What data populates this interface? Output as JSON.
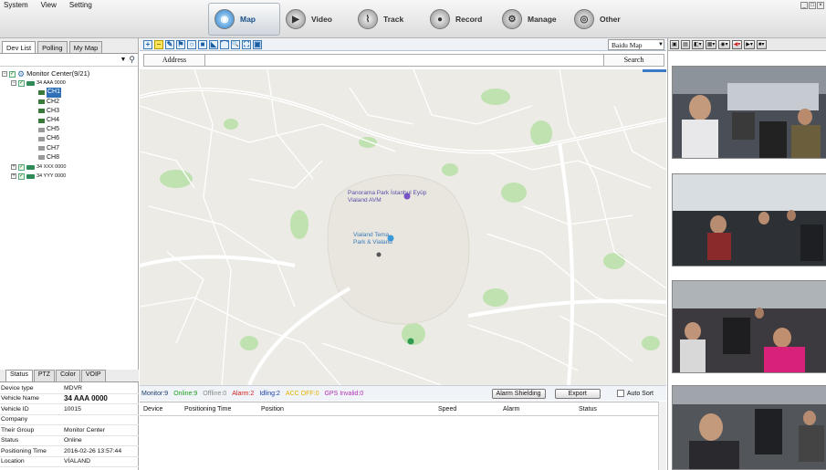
{
  "menu": [
    "System",
    "View",
    "Setting"
  ],
  "nav": [
    {
      "label": "Map",
      "icon": "globe-icon",
      "active": true
    },
    {
      "label": "Video",
      "icon": "video-icon",
      "active": false
    },
    {
      "label": "Track",
      "icon": "track-icon",
      "active": false
    },
    {
      "label": "Record",
      "icon": "record-icon",
      "active": false
    },
    {
      "label": "Manage",
      "icon": "manage-icon",
      "active": false
    },
    {
      "label": "Other",
      "icon": "other-icon",
      "active": false
    }
  ],
  "left_tabs": [
    "Dev List",
    "Polling",
    "My Map"
  ],
  "tree": {
    "root": "Monitor Center(9/21)",
    "vehicle1": "34 AAA 0000",
    "channels": [
      "CH1",
      "CH2",
      "CH3",
      "CH4",
      "CH5",
      "CH6",
      "CH7",
      "CH8"
    ],
    "vehicle2": "34 XXX 0000",
    "vehicle3": "34 YYY 0000"
  },
  "status_tabs": [
    "Status",
    "PTZ",
    "Color",
    "VOIP"
  ],
  "info": [
    {
      "k": "Device type",
      "v": "MDVR"
    },
    {
      "k": "Vehicle Name",
      "v": "34 AAA 0000"
    },
    {
      "k": "Vehicle ID",
      "v": "10015"
    },
    {
      "k": "Company",
      "v": ""
    },
    {
      "k": "Their Group",
      "v": "Monitor Center"
    },
    {
      "k": "Status",
      "v": "Online"
    },
    {
      "k": "Positioning Time",
      "v": "2016-02-26 13:57:44"
    },
    {
      "k": "Location",
      "v": "VİALAND"
    }
  ],
  "map_toolbar": [
    "+",
    "−",
    "✎",
    "⚑",
    "○",
    "■",
    "◣",
    "⌒",
    "🔍",
    "⛶",
    "▣"
  ],
  "map_select": "Baidu Map",
  "address_label": "Address",
  "search_label": "Search",
  "map_labels": {
    "park1": "Panorama Park İstanbul Eyüp Vialand AVM",
    "park2": "Vialand Tema Park & Vialand"
  },
  "counts": {
    "monitor": "Monitor:9",
    "online": "Online:9",
    "offline": "Offline:0",
    "alarm": "Alarm:2",
    "idling": "Idling:2",
    "acc_off": "ACC OFF:0",
    "gps_invalid": "GPS Invalid:0"
  },
  "buttons": {
    "alarm_shielding": "Alarm Shielding",
    "export": "Export",
    "auto_sort": "Auto Sort"
  },
  "grid_columns": [
    "Device",
    "Positioning Time",
    "Position",
    "Speed",
    "Alarm",
    "Status"
  ],
  "colors": {
    "online": "#1e9e1e",
    "offline": "#888888",
    "alarm": "#d42020",
    "idling": "#1a3fa8",
    "acc_off": "#e0b000",
    "gps_invalid": "#b030b0"
  }
}
